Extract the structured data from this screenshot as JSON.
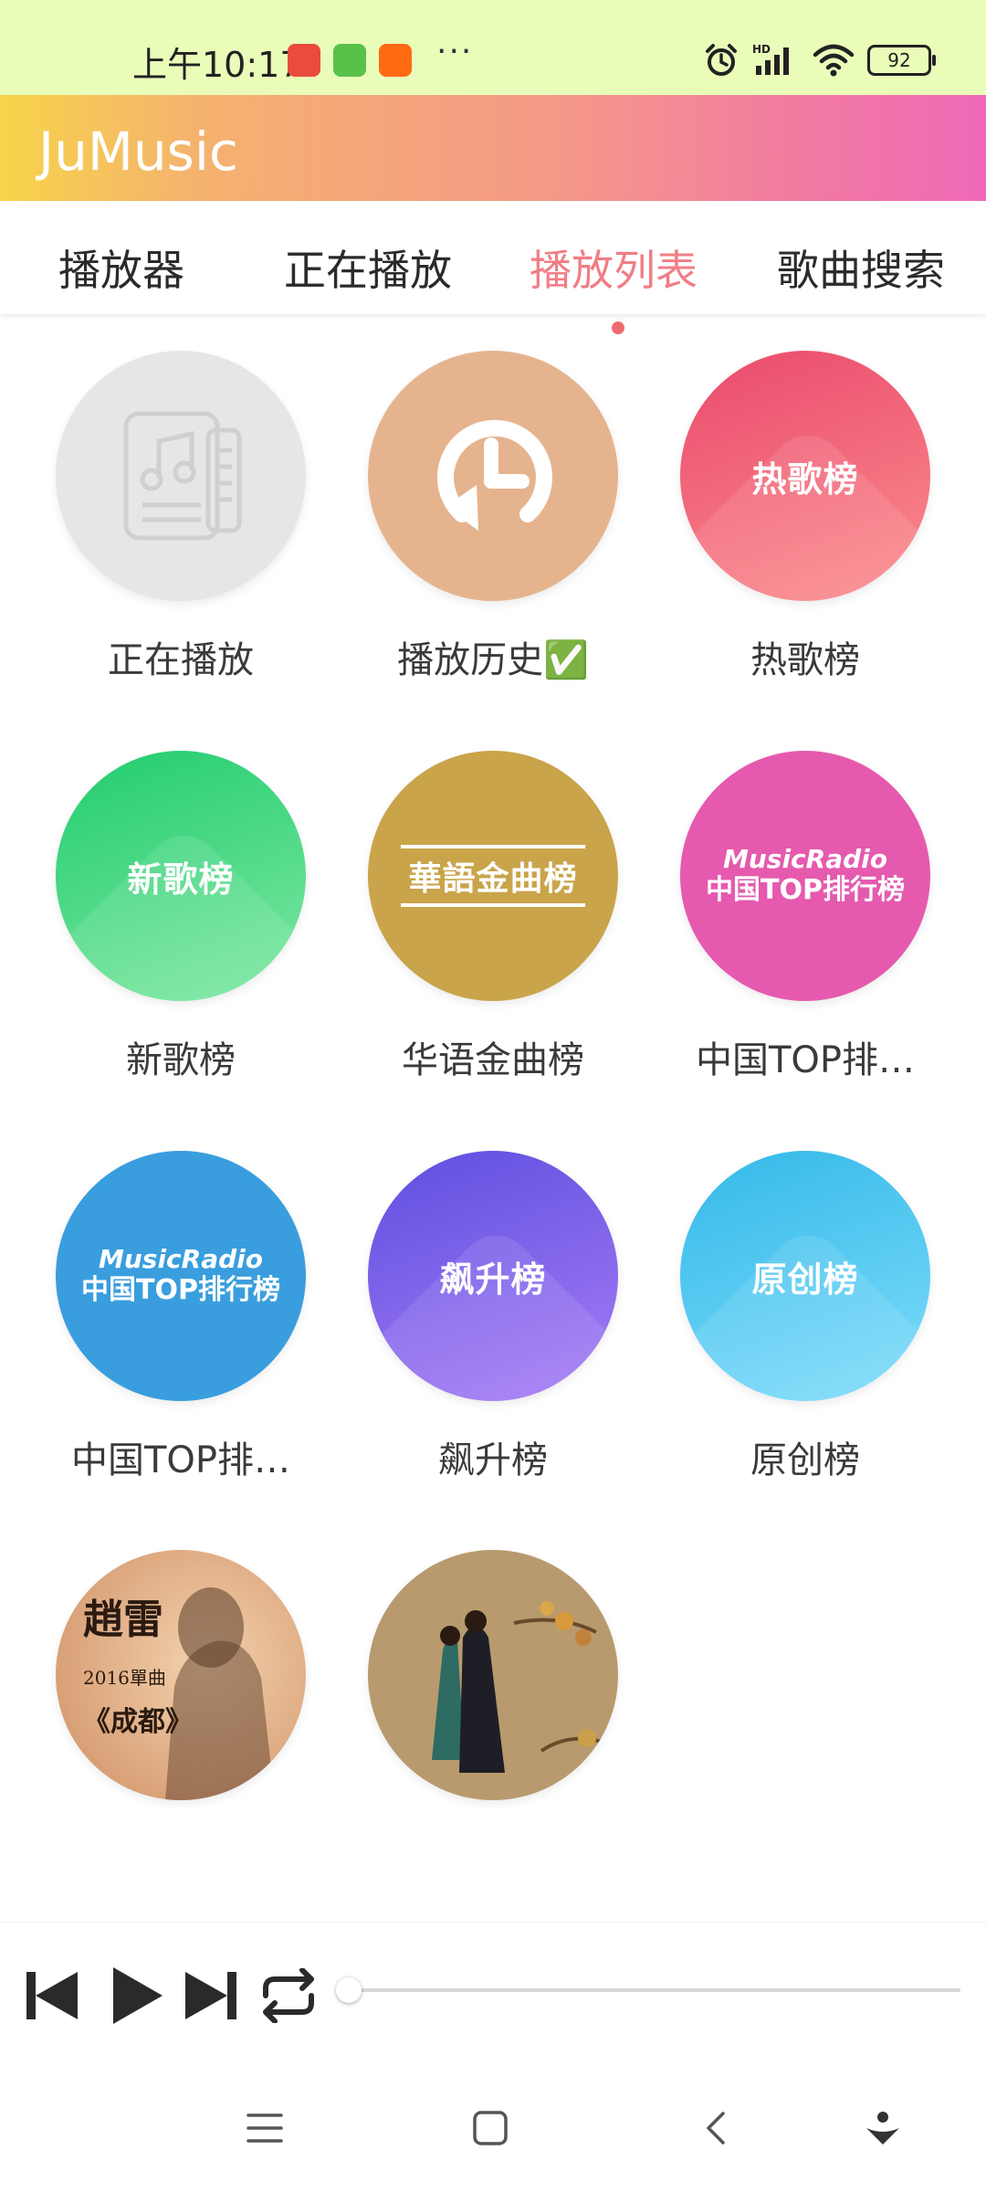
{
  "status_bar": {
    "time": "上午10:17",
    "more": "···",
    "signal_label": "HD",
    "battery": "92"
  },
  "app": {
    "title": "JuMusic"
  },
  "tabs": [
    {
      "label": "播放器"
    },
    {
      "label": "正在播放"
    },
    {
      "label": "播放列表",
      "active": true
    },
    {
      "label": "歌曲搜索"
    }
  ],
  "playlists": [
    {
      "label": "正在播放",
      "cover_text": "",
      "icon": "music-document-icon",
      "color": "#e6e6e6"
    },
    {
      "label": "播放历史✅",
      "cover_text": "",
      "icon": "history-clock-icon",
      "color": "#e5b48f"
    },
    {
      "label": "热歌榜",
      "cover_text": "热歌榜",
      "color": "#f0607a"
    },
    {
      "label": "新歌榜",
      "cover_text": "新歌榜",
      "color": "#3ad67f"
    },
    {
      "label": "华语金曲榜",
      "cover_text": "華語金曲榜",
      "color": "#c9a44a"
    },
    {
      "label": "中国TOP排…",
      "cover_text_top": "MusicRadio",
      "cover_text_bottom": "中国TOP排行榜",
      "color": "#e55aae"
    },
    {
      "label": "中国TOP排…",
      "cover_text_top": "MusicRadio",
      "cover_text_bottom": "中国TOP排行榜",
      "color": "#3a9ede"
    },
    {
      "label": "飙升榜",
      "cover_text": "飙升榜",
      "color": "#8b63e8"
    },
    {
      "label": "原创榜",
      "cover_text": "原创榜",
      "color": "#4fc8ee"
    },
    {
      "label": "",
      "cover_text_1": "趙雷",
      "cover_text_2": "2016單曲",
      "cover_text_3": "《成都》",
      "color": "#d9a27a"
    },
    {
      "label": "",
      "cover_text": "",
      "color": "#b89a6e"
    }
  ],
  "player": {
    "progress": 0.0
  },
  "colors": {
    "accent": "#f07e86",
    "status_bar_bg": "#e9fdb9"
  }
}
